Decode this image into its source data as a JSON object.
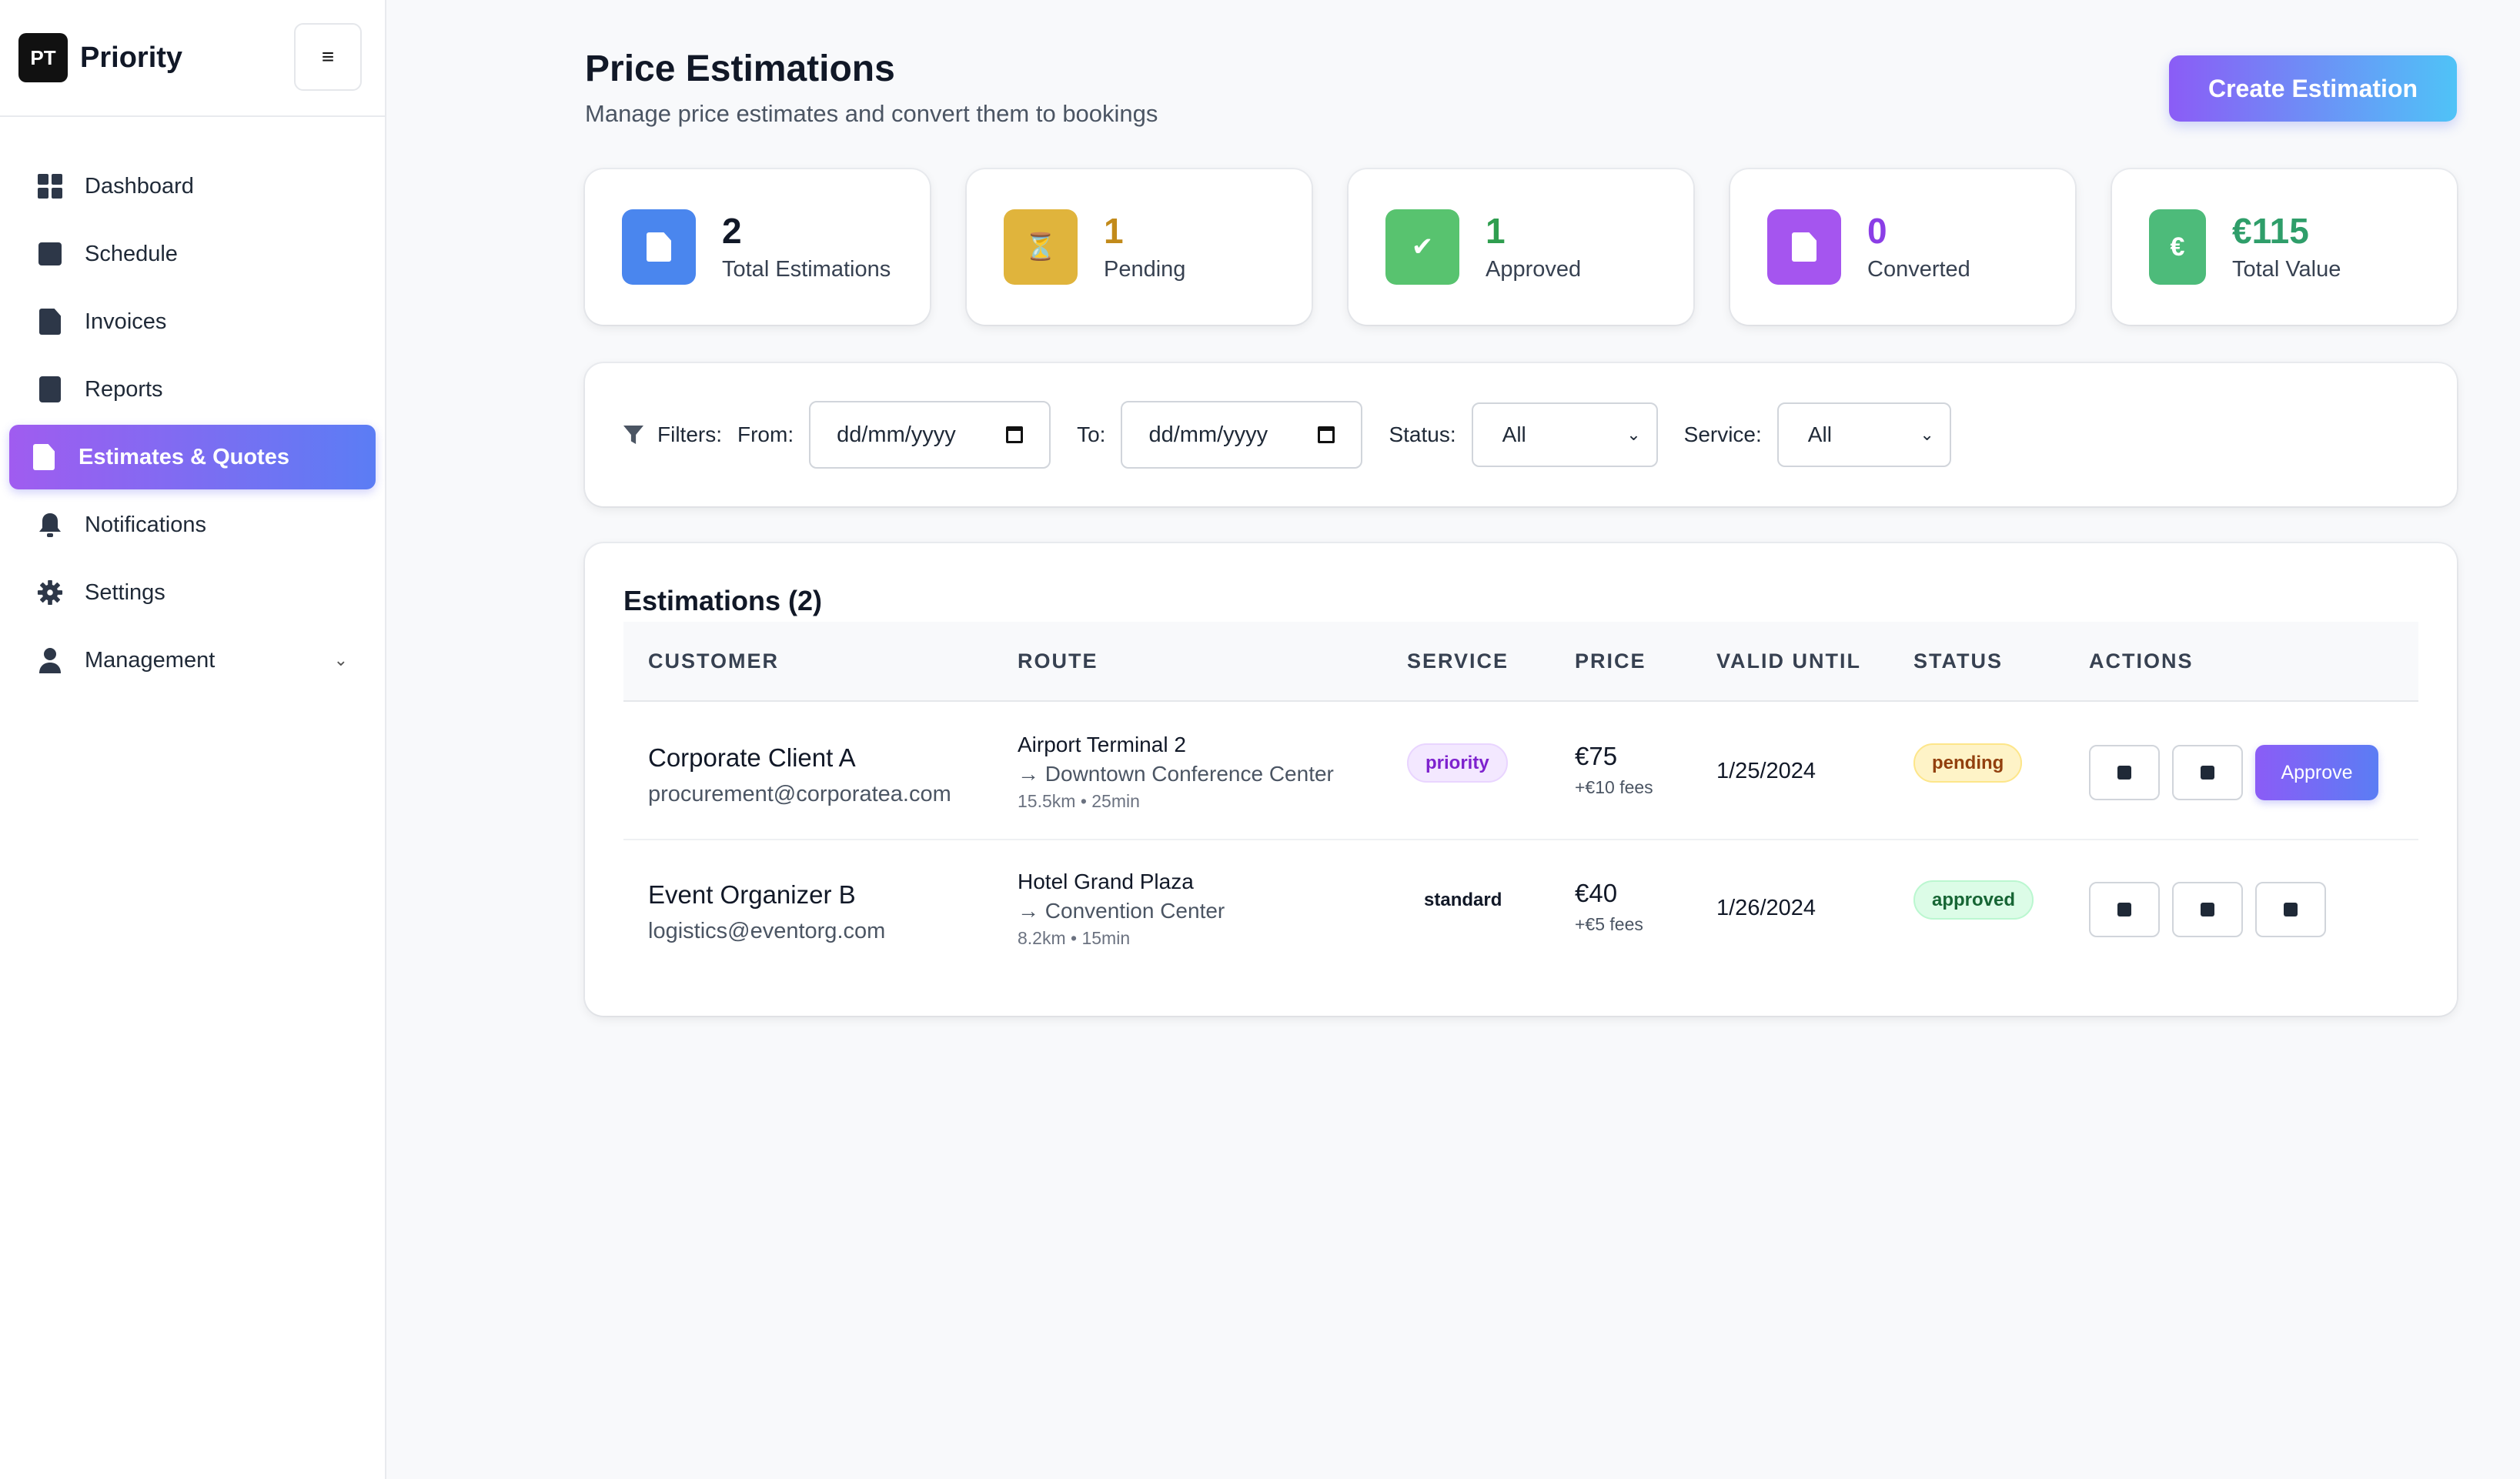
{
  "brand": {
    "logo_text": "PT",
    "name": "Priority",
    "menu_icon": "≡"
  },
  "sidebar": {
    "items": [
      {
        "label": "Dashboard",
        "icon": "dashboard-icon"
      },
      {
        "label": "Schedule",
        "icon": "calendar-icon"
      },
      {
        "label": "Invoices",
        "icon": "invoice-icon"
      },
      {
        "label": "Reports",
        "icon": "report-icon"
      },
      {
        "label": "Estimates & Quotes",
        "icon": "document-icon",
        "active": true
      },
      {
        "label": "Notifications",
        "icon": "bell-icon"
      },
      {
        "label": "Settings",
        "icon": "gear-icon"
      },
      {
        "label": "Management",
        "icon": "user-icon",
        "expandable": true
      }
    ]
  },
  "header": {
    "title": "Price Estimations",
    "subtitle": "Manage price estimates and convert them to bookings",
    "create_label": "Create Estimation"
  },
  "stats": [
    {
      "value": "2",
      "label": "Total Estimations",
      "color": "#3b82f6",
      "value_color": "#111827"
    },
    {
      "value": "1",
      "label": "Pending",
      "color": "#e0b43c",
      "value_color": "#c28a1a",
      "icon": "⏳"
    },
    {
      "value": "1",
      "label": "Approved",
      "color": "#4cc06a",
      "value_color": "#2f9e4f",
      "icon": "✔"
    },
    {
      "value": "0",
      "label": "Converted",
      "color": "#a855f7",
      "value_color": "#8b3ee6"
    },
    {
      "value": "€115",
      "label": "Total Value",
      "color": "#4dbb7a",
      "value_color": "#2f9e6a",
      "icon": "€"
    }
  ],
  "filters": {
    "label": "Filters:",
    "from_label": "From:",
    "from_value": "dd/mm/yyyy",
    "to_label": "To:",
    "to_value": "dd/mm/yyyy",
    "status_label": "Status:",
    "status_value": "All",
    "service_label": "Service:",
    "service_value": "All"
  },
  "table": {
    "title": "Estimations (2)",
    "columns": [
      "CUSTOMER",
      "ROUTE",
      "SERVICE",
      "PRICE",
      "VALID UNTIL",
      "STATUS",
      "ACTIONS"
    ],
    "rows": [
      {
        "customer": "Corporate Client A",
        "email": "procurement@corporatea.com",
        "route_from": "Airport Terminal 2",
        "route_to": "→ Downtown Conference Center",
        "route_meta": "15.5km • 25min",
        "service": "priority",
        "price": "€75",
        "fees": "+€10 fees",
        "valid_until": "1/25/2024",
        "status": "pending",
        "approve_label": "Approve"
      },
      {
        "customer": "Event Organizer B",
        "email": "logistics@eventorg.com",
        "route_from": "Hotel Grand Plaza",
        "route_to": "→ Convention Center",
        "route_meta": "8.2km • 15min",
        "service": "standard",
        "price": "€40",
        "fees": "+€5 fees",
        "valid_until": "1/26/2024",
        "status": "approved"
      }
    ]
  }
}
